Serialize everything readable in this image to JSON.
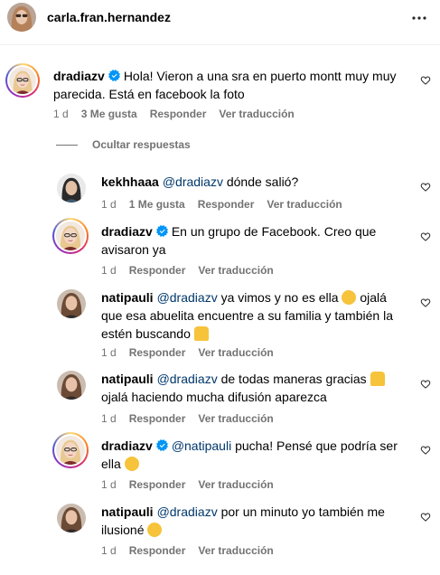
{
  "header": {
    "username": "carla.fran.hernandez",
    "more_icon": "more-horizontal-icon"
  },
  "colors": {
    "mention": "#00376b",
    "meta": "#737373",
    "verified": "#0095f6"
  },
  "main_comment": {
    "username": "dradiazv",
    "text": "Hola! Vieron a una sra en puerto montt muy muy parecida. Está en facebook la foto",
    "time": "1 d",
    "likes": "3 Me gusta",
    "reply": "Responder",
    "translate": "Ver traducción"
  },
  "hide_replies": "Ocultar respuestas",
  "replies": [
    {
      "username": "kekhhaaa",
      "mention": "@dradiazv",
      "text_line1": " dónde salió?",
      "text_line2": "",
      "time": "1 d",
      "likes": "1 Me gusta",
      "reply": "Responder",
      "translate": "Ver traducción"
    },
    {
      "username": "dradiazv",
      "mention": "",
      "text_line1": "En un grupo de Facebook. Creo que",
      "text_line2": "avisaron ya",
      "time": "1 d",
      "likes": "",
      "reply": "Responder",
      "translate": "Ver traducción"
    },
    {
      "username": "natipauli",
      "mention": "@dradiazv",
      "text_line1": " ya vimos y no es ella ",
      "text_line2": "ojalá",
      "text_line3": "que esa abuelita encuentre a su familia y también la",
      "text_line4": "estén buscando",
      "time": "1 d",
      "likes": "",
      "reply": "Responder",
      "translate": "Ver traducción"
    },
    {
      "username": "natipauli",
      "mention": "@dradiazv",
      "text_line1": " de todas maneras gracias",
      "text_line2": "ojalá haciendo mucha difusión aparezca",
      "time": "1 d",
      "likes": "",
      "reply": "Responder",
      "translate": "Ver traducción"
    },
    {
      "username": "dradiazv",
      "mention": "@natipauli",
      "text_line1": " pucha! Pensé que podría ser",
      "text_line2": "ella",
      "time": "1 d",
      "likes": "",
      "reply": "Responder",
      "translate": "Ver traducción"
    },
    {
      "username": "natipauli",
      "mention": "@dradiazv",
      "text_line1": " por un minuto yo también me",
      "text_line2": "ilusioné",
      "time": "1 d",
      "likes": "",
      "reply": "Responder",
      "translate": "Ver traducción"
    }
  ]
}
